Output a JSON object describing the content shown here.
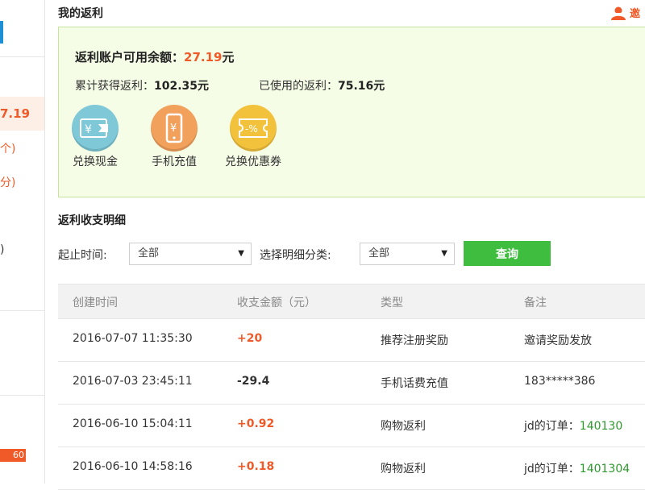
{
  "sidebar": {
    "balance_fragment": "7.19",
    "line1_fragment": "个)",
    "line2_fragment": "分)",
    "line3_fragment": ")",
    "badge": "60"
  },
  "header": {
    "title": "我的返利",
    "invite_label": "邀",
    "invite_icon": "user-avatar-icon"
  },
  "summary": {
    "available_label": "返利账户可用余额：",
    "available_amount": "27.19",
    "available_unit": "元",
    "earned_label": "累计获得返利：",
    "earned_amount": "102.35元",
    "used_label": "已使用的返利：",
    "used_amount": "75.16元",
    "actions": [
      {
        "label": "兑换现金",
        "icon": "cash-exchange-icon",
        "color": "#7ec8d8"
      },
      {
        "label": "手机充值",
        "icon": "mobile-recharge-icon",
        "color": "#f2a15c"
      },
      {
        "label": "兑换优惠券",
        "icon": "coupon-icon",
        "color": "#f3c23d"
      }
    ]
  },
  "detail": {
    "title": "返利收支明细",
    "time_label": "起止时间:",
    "time_value": "全部",
    "category_label": "选择明细分类:",
    "category_value": "全部",
    "query_button": "查询"
  },
  "table": {
    "columns": [
      "创建时间",
      "收支金额（元）",
      "类型",
      "备注"
    ],
    "rows": [
      {
        "time": "2016-07-07 11:35:30",
        "amount": "+20",
        "type": "推荐注册奖励",
        "note": "邀请奖励发放",
        "note_extra": ""
      },
      {
        "time": "2016-07-03 23:45:11",
        "amount": "-29.4",
        "type": "手机话费充值",
        "note": "183*****386",
        "note_extra": ""
      },
      {
        "time": "2016-06-10 15:04:11",
        "amount": "+0.92",
        "type": "购物返利",
        "note": "jd的订单：",
        "note_extra": "140130"
      },
      {
        "time": "2016-06-10 14:58:16",
        "amount": "+0.18",
        "type": "购物返利",
        "note": "jd的订单：",
        "note_extra": "1401304"
      }
    ]
  },
  "colors": {
    "accent": "#f05a28",
    "success": "#3fbd3f",
    "summary_bg": "#f5fde6"
  }
}
